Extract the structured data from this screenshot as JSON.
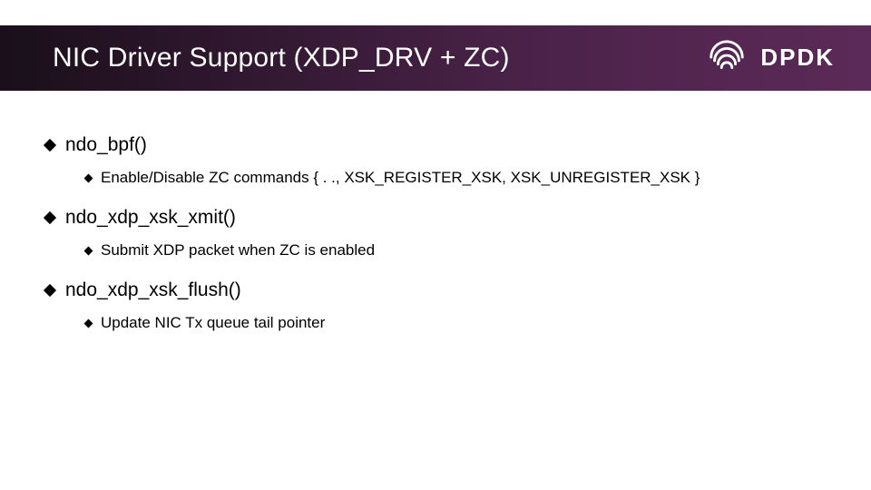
{
  "header": {
    "title": "NIC Driver Support (XDP_DRV + ZC)",
    "brand": "DPDK"
  },
  "bullets": [
    {
      "label": "ndo_bpf()",
      "children": [
        {
          "label": "Enable/Disable ZC commands { . ., XSK_REGISTER_XSK, XSK_UNREGISTER_XSK }"
        }
      ]
    },
    {
      "label": "ndo_xdp_xsk_xmit()",
      "children": [
        {
          "label": "Submit XDP packet when ZC is enabled"
        }
      ]
    },
    {
      "label": "ndo_xdp_xsk_flush()",
      "children": [
        {
          "label": "Update NIC Tx queue tail pointer"
        }
      ]
    }
  ]
}
